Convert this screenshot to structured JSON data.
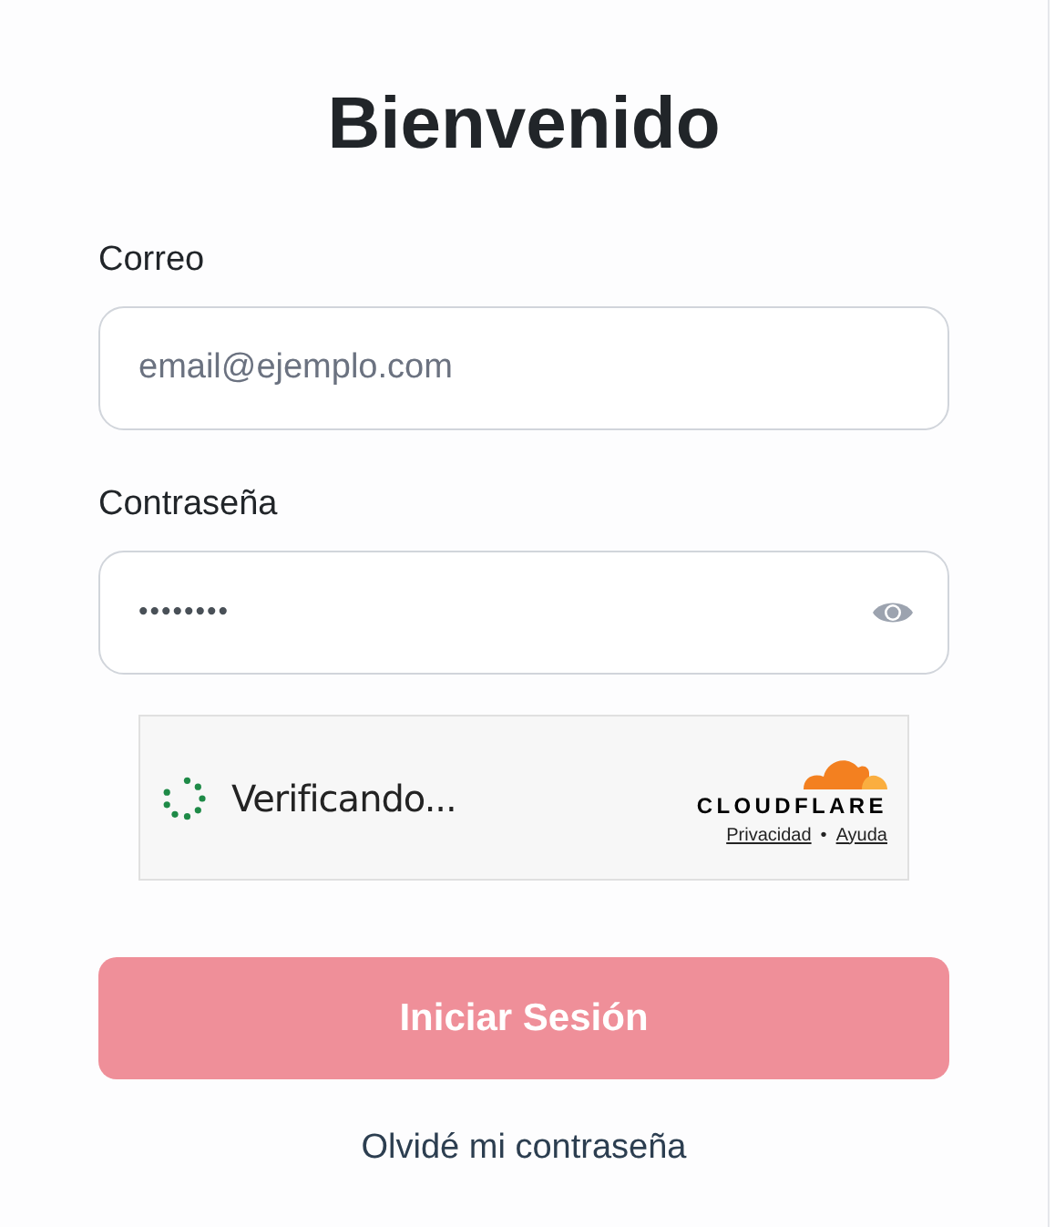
{
  "title": "Bienvenido",
  "email": {
    "label": "Correo",
    "placeholder": "email@ejemplo.com"
  },
  "password": {
    "label": "Contraseña",
    "value": "••••••••"
  },
  "captcha": {
    "status": "Verificando...",
    "brand": "CLOUDFLARE",
    "links": [
      "Privacidad",
      "Ayuda"
    ],
    "separator": "•"
  },
  "submit": {
    "label": "Iniciar Sesión",
    "disabled": true
  },
  "forgot_link": "Olvidé mi contraseña"
}
